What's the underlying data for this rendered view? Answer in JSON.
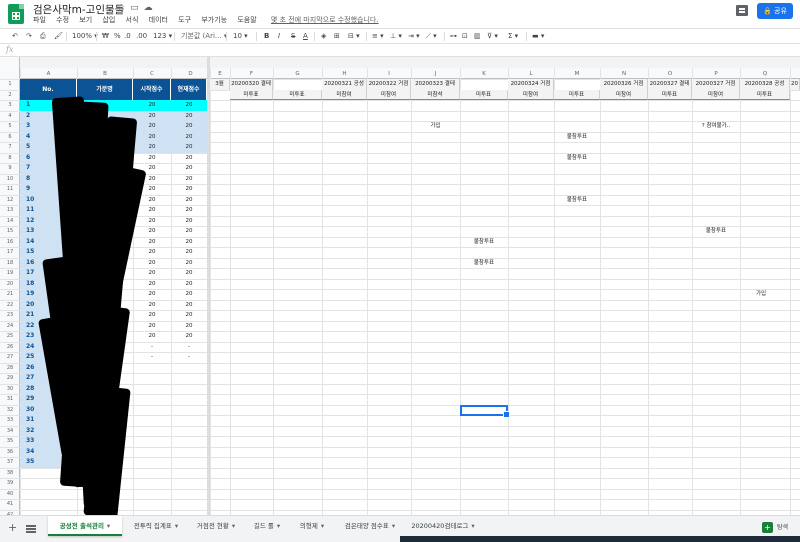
{
  "app": {
    "title": "검은사막m-고인물들",
    "menu": [
      "파일",
      "수정",
      "보기",
      "삽입",
      "서식",
      "데이터",
      "도구",
      "부가기능",
      "도움말"
    ],
    "last_edit": "몇 초 전에 마지막으로 수정했습니다.",
    "share_label": "공유"
  },
  "toolbar": {
    "zoom": "100%",
    "currency": "₩",
    "percent": "%",
    "decimals_dec": ".0",
    "decimals_inc": ".00",
    "format_more": "123",
    "font": "기본값 (Ari...",
    "font_size": "10",
    "bold": "B",
    "italic": "I",
    "strike": "S",
    "text_color": "A",
    "sum": "Σ"
  },
  "formula_bar": {
    "fx": "fx"
  },
  "columns": [
    "A",
    "B",
    "C",
    "D",
    "E",
    "F",
    "G",
    "H",
    "I",
    "J",
    "K",
    "L",
    "M",
    "N",
    "O",
    "P",
    "Q"
  ],
  "rows": [
    "1",
    "2",
    "3",
    "4",
    "5",
    "6",
    "7",
    "8",
    "9",
    "10",
    "11",
    "12",
    "13",
    "14",
    "15",
    "16",
    "17",
    "18",
    "19",
    "20",
    "21",
    "22",
    "23",
    "24",
    "25",
    "26",
    "27",
    "28",
    "29",
    "30",
    "31",
    "32",
    "33",
    "34",
    "35",
    "36",
    "37",
    "38",
    "39",
    "40",
    "41",
    "42",
    "43",
    "44",
    "45",
    "46"
  ],
  "frozen_header": {
    "no": "No.",
    "name": "가문명",
    "start_score": "시작점수",
    "current_score": "현재점수"
  },
  "date_headers": {
    "E": "3월",
    "F": "20200320 결테",
    "H": "20200321 공성",
    "I": "20200322 거점",
    "J": "20200323 결테",
    "L": "20200324 거점",
    "N": "20200326 거점",
    "O": "20200327 결테",
    "P": "20200327 거점",
    "Q": "20200328 공성",
    "R": "20"
  },
  "sub_headers": [
    "미투표",
    "미투표",
    "미참여",
    "미참여",
    "미참석",
    "미투표",
    "미참여",
    "미투표",
    "미참여",
    "미투표",
    "미참여",
    "미투표"
  ],
  "data_rows": [
    {
      "no": "1",
      "start": "20",
      "current": "20"
    },
    {
      "no": "2",
      "start": "20",
      "current": "20"
    },
    {
      "no": "3",
      "start": "20",
      "current": "20"
    },
    {
      "no": "4",
      "start": "20",
      "current": "20"
    },
    {
      "no": "5",
      "start": "20",
      "current": "20"
    },
    {
      "no": "6",
      "start": "20",
      "current": "20"
    },
    {
      "no": "7",
      "start": "20",
      "current": "20"
    },
    {
      "no": "8",
      "start": "20",
      "current": "20"
    },
    {
      "no": "9",
      "start": "20",
      "current": "20"
    },
    {
      "no": "10",
      "start": "20",
      "current": "20"
    },
    {
      "no": "11",
      "start": "20",
      "current": "20"
    },
    {
      "no": "12",
      "start": "20",
      "current": "20"
    },
    {
      "no": "13",
      "start": "20",
      "current": "20"
    },
    {
      "no": "14",
      "start": "20",
      "current": "20"
    },
    {
      "no": "15",
      "start": "20",
      "current": "20"
    },
    {
      "no": "16",
      "start": "20",
      "current": "20"
    },
    {
      "no": "17",
      "start": "20",
      "current": "20"
    },
    {
      "no": "18",
      "start": "20",
      "current": "20"
    },
    {
      "no": "19",
      "start": "20",
      "current": "20"
    },
    {
      "no": "20",
      "start": "20",
      "current": "20"
    },
    {
      "no": "21",
      "start": "20",
      "current": "20"
    },
    {
      "no": "22",
      "start": "20",
      "current": "20"
    },
    {
      "no": "23",
      "start": "20",
      "current": "20"
    },
    {
      "no": "24",
      "start": "-",
      "current": "-"
    },
    {
      "no": "25",
      "start": "-",
      "current": "-"
    },
    {
      "no": "26",
      "start": "",
      "current": ""
    },
    {
      "no": "27",
      "start": "",
      "current": ""
    },
    {
      "no": "28",
      "start": "",
      "current": ""
    },
    {
      "no": "29",
      "start": "",
      "current": ""
    },
    {
      "no": "30",
      "start": "",
      "current": ""
    },
    {
      "no": "31",
      "start": "",
      "current": ""
    },
    {
      "no": "32",
      "start": "",
      "current": ""
    },
    {
      "no": "33",
      "start": "",
      "current": ""
    },
    {
      "no": "34",
      "start": "",
      "current": ""
    },
    {
      "no": "35",
      "start": "",
      "current": ""
    }
  ],
  "notes": {
    "join_j": "가입",
    "warn_p": "? 참여불가..",
    "absent_m5": "불참투표",
    "absent_m7": "불참투표",
    "absent_m11": "불참투표",
    "absent_p14": "불참투표",
    "absent_k15": "불참투표",
    "absent_k17": "불참투표",
    "join_q20": "가입"
  },
  "sheet_tabs": [
    {
      "label": "공성전 출석관리",
      "active": true
    },
    {
      "label": "전투력 집계표",
      "active": false
    },
    {
      "label": "거점전 현황",
      "active": false
    },
    {
      "label": "길드 롤",
      "active": false
    },
    {
      "label": "의형제",
      "active": false
    },
    {
      "label": "검은태양 점수표",
      "active": false
    },
    {
      "label": "20200420검테로그",
      "active": false
    }
  ],
  "explore_label": "탐색",
  "colors": {
    "header_blue": "#0b5394",
    "highlight_cyan": "#00ffff",
    "selection_blue": "#cfe2f3",
    "accent_green": "#188038",
    "share_blue": "#1a73e8"
  }
}
